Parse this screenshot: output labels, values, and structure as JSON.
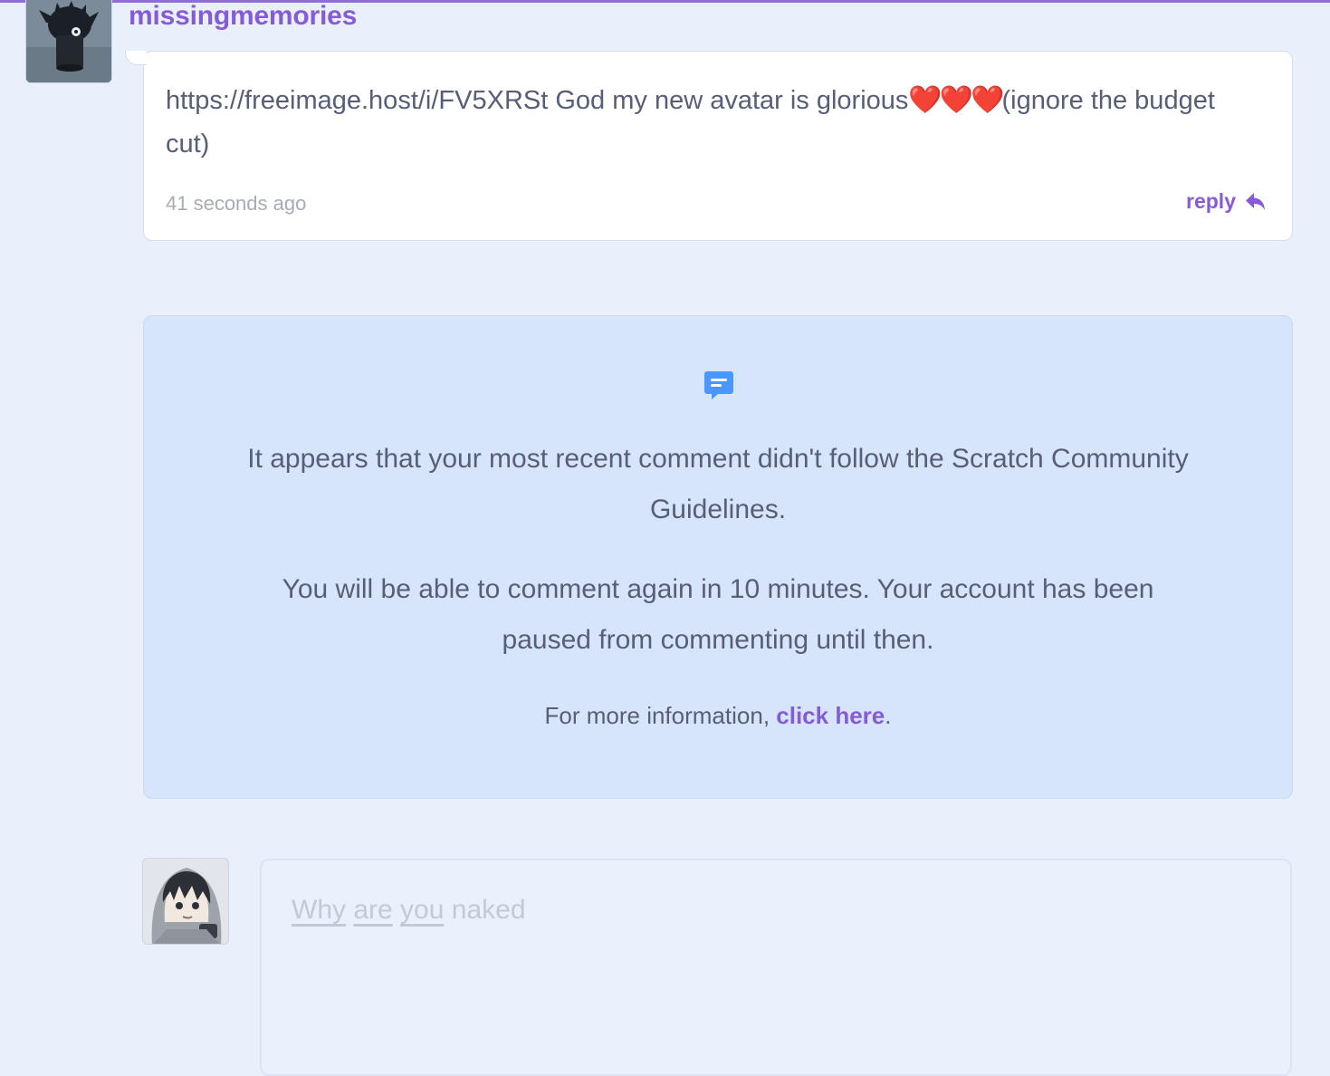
{
  "comment": {
    "author": "missingmemories",
    "text_part1": "https://freeimage.host/i/FV5XRSt God my new avatar is glorious",
    "hearts": "❤️❤️❤️",
    "text_part2": "(ignore the budget cut)",
    "timestamp": "41 seconds ago",
    "reply_label": "reply",
    "avatar_icon": "user-avatar-icon",
    "reply_icon": "reply-arrow-icon"
  },
  "notice": {
    "icon": "comment-bubble-icon",
    "paragraph1": "It appears that your most recent comment didn't follow the Scratch Community Guidelines.",
    "paragraph2": "You will be able to comment again in 10 minutes. Your account has been paused from commenting until then.",
    "info_prefix": "For more information, ",
    "info_link": "click here",
    "info_suffix": "."
  },
  "compose": {
    "avatar_icon": "current-user-avatar-icon",
    "words": [
      "Why",
      "are",
      "you",
      "naked"
    ]
  },
  "colors": {
    "accent": "#855cd6",
    "background": "#e9f0fb",
    "notice_bg": "#d7e5fb",
    "text": "#575e75",
    "heart": "#e4252f",
    "icon_blue": "#4c97ff"
  }
}
